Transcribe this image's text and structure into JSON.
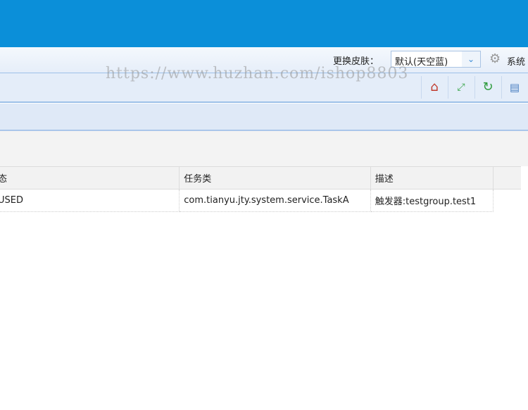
{
  "header": {
    "skin_label": "更换皮肤：",
    "skin_value": "默认(天空蓝)",
    "system_label": "系统"
  },
  "toolbar": {
    "icons": [
      "home-icon",
      "fullscreen-icon",
      "refresh-icon",
      "settings-panel-icon"
    ]
  },
  "table": {
    "columns": [
      "态",
      "任务类",
      "描述",
      ""
    ],
    "rows": [
      [
        "USED",
        "com.tianyu.jty.system.service.TaskA",
        "触发器:testgroup.test1",
        ""
      ]
    ]
  },
  "watermark": "https://www.huzhan.com/ishop8803"
}
